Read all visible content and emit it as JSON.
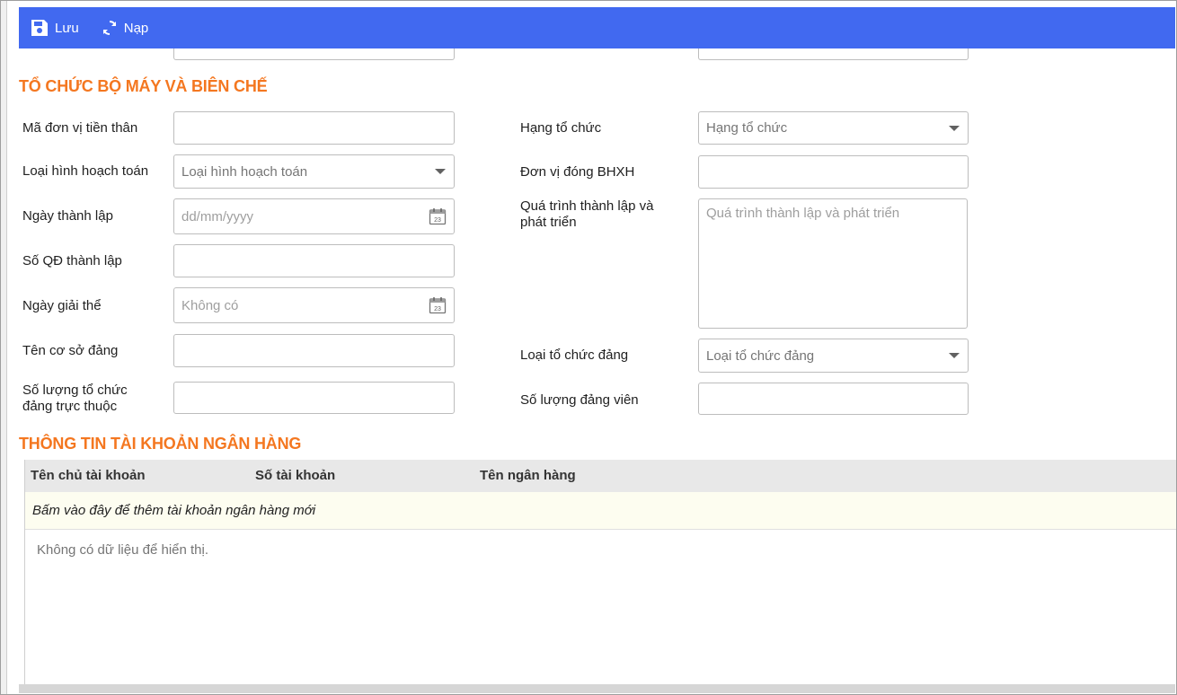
{
  "toolbar": {
    "save_label": "Lưu",
    "reload_label": "Nạp",
    "background": "#4169f0"
  },
  "section_org": {
    "title": "TỔ CHỨC BỘ MÁY VÀ BIÊN CHẾ",
    "fields": {
      "predecessor_code": {
        "label": "Mã đơn vị tiền thân",
        "value": ""
      },
      "accounting_type": {
        "label": "Loại hình hoạch toán",
        "placeholder": "Loại hình hoạch toán"
      },
      "founding_date": {
        "label": "Ngày thành lập",
        "placeholder": "dd/mm/yyyy"
      },
      "founding_decision_no": {
        "label": "Số QĐ thành lập",
        "value": ""
      },
      "dissolution_date": {
        "label": "Ngày giải thể",
        "placeholder": "Không có"
      },
      "party_base_name": {
        "label": "Tên cơ sở đảng",
        "value": ""
      },
      "party_org_count": {
        "label": "Số lượng tổ chức đảng trực thuộc",
        "value": ""
      },
      "org_rank": {
        "label": "Hạng tổ chức",
        "placeholder": "Hạng tổ chức"
      },
      "social_insurance_unit": {
        "label": "Đơn vị đóng BHXH",
        "value": ""
      },
      "history": {
        "label": "Quá trình thành lập và phát triển",
        "placeholder": "Quá trình thành lập và phát triển"
      },
      "party_org_type": {
        "label": "Loại tổ chức đảng",
        "placeholder": "Loại tổ chức đảng"
      },
      "party_member_count": {
        "label": "Số lượng đảng viên",
        "value": ""
      }
    },
    "calendar_day": "23"
  },
  "section_bank": {
    "title": "THÔNG TIN TÀI KHOẢN NGÂN HÀNG",
    "columns": [
      "Tên chủ tài khoản",
      "Số tài khoản",
      "Tên ngân hàng"
    ],
    "add_row_text": "Bấm vào đây để thêm tài khoản ngân hàng mới",
    "empty_text": "Không có dữ liệu để hiển thị."
  },
  "colors": {
    "section_title": "#f47720",
    "toolbar": "#4169f0"
  }
}
